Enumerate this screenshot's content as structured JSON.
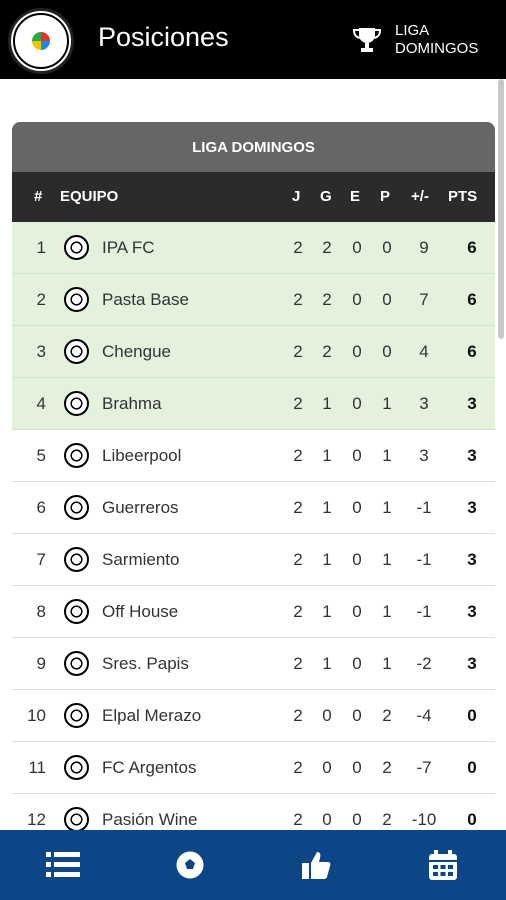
{
  "header": {
    "title": "Posiciones",
    "league_label_line1": "LIGA",
    "league_label_line2": "DOMINGOS",
    "logo_text": "TORNEO CHORI Y BIRRA"
  },
  "table": {
    "title": "LIGA DOMINGOS",
    "columns": [
      "#",
      "EQUIPO",
      "J",
      "G",
      "E",
      "P",
      "+/-",
      "PTS"
    ],
    "rows": [
      {
        "pos": "1",
        "team": "IPA FC",
        "j": "2",
        "g": "2",
        "e": "0",
        "p": "0",
        "diff": "9",
        "pts": "6"
      },
      {
        "pos": "2",
        "team": "Pasta Base",
        "j": "2",
        "g": "2",
        "e": "0",
        "p": "0",
        "diff": "7",
        "pts": "6"
      },
      {
        "pos": "3",
        "team": "Chengue",
        "j": "2",
        "g": "2",
        "e": "0",
        "p": "0",
        "diff": "4",
        "pts": "6"
      },
      {
        "pos": "4",
        "team": "Brahma",
        "j": "2",
        "g": "1",
        "e": "0",
        "p": "1",
        "diff": "3",
        "pts": "3"
      },
      {
        "pos": "5",
        "team": "Libeerpool",
        "j": "2",
        "g": "1",
        "e": "0",
        "p": "1",
        "diff": "3",
        "pts": "3"
      },
      {
        "pos": "6",
        "team": "Guerreros",
        "j": "2",
        "g": "1",
        "e": "0",
        "p": "1",
        "diff": "-1",
        "pts": "3"
      },
      {
        "pos": "7",
        "team": "Sarmiento",
        "j": "2",
        "g": "1",
        "e": "0",
        "p": "1",
        "diff": "-1",
        "pts": "3"
      },
      {
        "pos": "8",
        "team": "Off House",
        "j": "2",
        "g": "1",
        "e": "0",
        "p": "1",
        "diff": "-1",
        "pts": "3"
      },
      {
        "pos": "9",
        "team": "Sres. Papis",
        "j": "2",
        "g": "1",
        "e": "0",
        "p": "1",
        "diff": "-2",
        "pts": "3"
      },
      {
        "pos": "10",
        "team": "Elpal Merazo",
        "j": "2",
        "g": "0",
        "e": "0",
        "p": "2",
        "diff": "-4",
        "pts": "0"
      },
      {
        "pos": "11",
        "team": "FC Argentos",
        "j": "2",
        "g": "0",
        "e": "0",
        "p": "2",
        "diff": "-7",
        "pts": "0"
      },
      {
        "pos": "12",
        "team": "Pasión Wine",
        "j": "2",
        "g": "0",
        "e": "0",
        "p": "2",
        "diff": "-10",
        "pts": "0"
      }
    ]
  },
  "bottom_nav": {
    "items": [
      "list-icon",
      "soccer-ball-icon",
      "thumbs-up-icon",
      "calendar-icon"
    ]
  },
  "colors": {
    "header_bg": "#000000",
    "nav_bg": "#0c4686",
    "qualified_row": "#e4f2dd"
  }
}
